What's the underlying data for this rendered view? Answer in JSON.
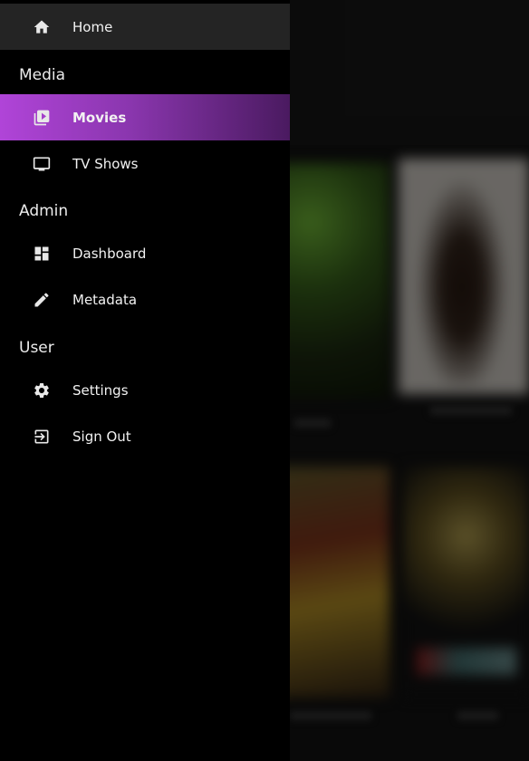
{
  "drawer": {
    "home": {
      "label": "Home",
      "icon": "home-icon"
    },
    "sections": [
      {
        "title": "Media",
        "items": [
          {
            "label": "Movies",
            "icon": "movie-library-icon",
            "selected": true
          },
          {
            "label": "TV Shows",
            "icon": "tv-icon",
            "selected": false
          }
        ]
      },
      {
        "title": "Admin",
        "items": [
          {
            "label": "Dashboard",
            "icon": "dashboard-icon"
          },
          {
            "label": "Metadata",
            "icon": "pencil-icon"
          }
        ]
      },
      {
        "title": "User",
        "items": [
          {
            "label": "Settings",
            "icon": "gear-icon"
          },
          {
            "label": "Sign Out",
            "icon": "sign-out-icon"
          }
        ]
      }
    ]
  },
  "colors": {
    "drawer_bg": "#000000",
    "selected_gradient_start": "#b044d8",
    "selected_gradient_end": "#4a1a60",
    "home_bg": "#242424",
    "text": "#f2f2f2"
  }
}
